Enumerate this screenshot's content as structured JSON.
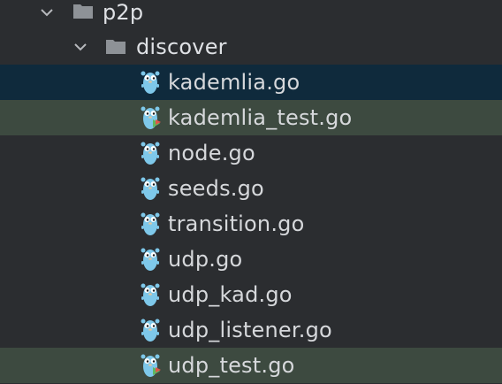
{
  "tree": {
    "folders": [
      {
        "label": "p2p",
        "expanded": true
      },
      {
        "label": "discover",
        "expanded": true
      }
    ],
    "files": [
      {
        "label": "kademlia.go",
        "icon": "go-gopher-icon",
        "state": "selected"
      },
      {
        "label": "kademlia_test.go",
        "icon": "go-test-gopher-icon",
        "state": "test"
      },
      {
        "label": "node.go",
        "icon": "go-gopher-icon",
        "state": "normal"
      },
      {
        "label": "seeds.go",
        "icon": "go-gopher-icon",
        "state": "normal"
      },
      {
        "label": "transition.go",
        "icon": "go-gopher-icon",
        "state": "normal"
      },
      {
        "label": "udp.go",
        "icon": "go-gopher-icon",
        "state": "normal"
      },
      {
        "label": "udp_kad.go",
        "icon": "go-gopher-icon",
        "state": "normal"
      },
      {
        "label": "udp_listener.go",
        "icon": "go-gopher-icon",
        "state": "normal"
      },
      {
        "label": "udp_test.go",
        "icon": "go-test-gopher-icon",
        "state": "test"
      }
    ]
  },
  "colors": {
    "background": "#2b2d30",
    "selected_row": "#0f2a3c",
    "test_row": "#3d4a40",
    "text": "#d6d8db",
    "gopher_blue": "#7ec8ea",
    "test_marker": "#5fb85f"
  }
}
